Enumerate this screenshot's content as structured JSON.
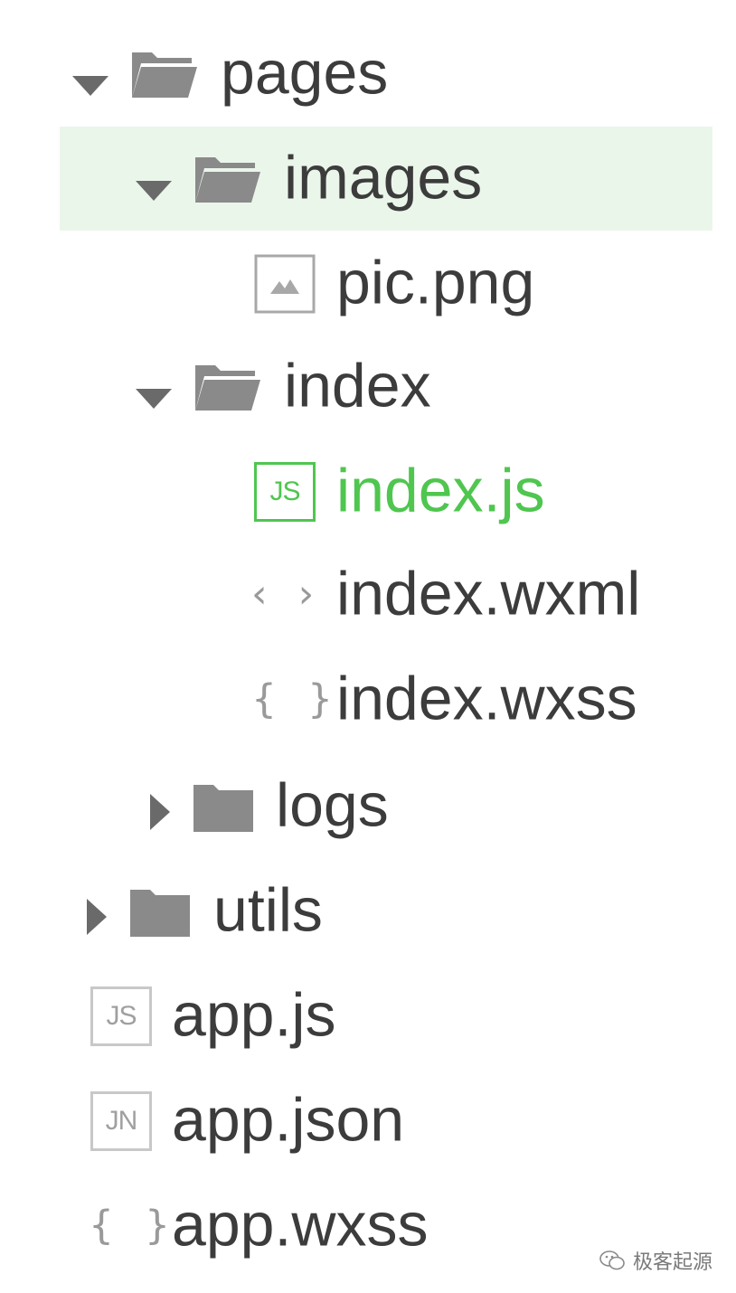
{
  "tree": {
    "pages": {
      "label": "pages",
      "icon": "folder-open-icon",
      "expanded": true
    },
    "images": {
      "label": "images",
      "icon": "folder-open-icon",
      "expanded": true,
      "selected": true
    },
    "pic_png": {
      "label": "pic.png",
      "icon": "image-file-icon"
    },
    "index_folder": {
      "label": "index",
      "icon": "folder-open-icon",
      "expanded": true
    },
    "index_js": {
      "label": "index.js",
      "icon": "js-file-icon",
      "badge": "JS",
      "active": true
    },
    "index_wxml": {
      "label": "index.wxml",
      "icon": "code-file-icon",
      "glyph": "‹ ›"
    },
    "index_wxss": {
      "label": "index.wxss",
      "icon": "style-file-icon",
      "glyph": "{ }"
    },
    "logs": {
      "label": "logs",
      "icon": "folder-closed-icon",
      "expanded": false
    },
    "utils": {
      "label": "utils",
      "icon": "folder-closed-icon",
      "expanded": false
    },
    "app_js": {
      "label": "app.js",
      "icon": "js-file-icon",
      "badge": "JS"
    },
    "app_json": {
      "label": "app.json",
      "icon": "json-file-icon",
      "badge": "JN"
    },
    "app_wxss": {
      "label": "app.wxss",
      "icon": "style-file-icon",
      "glyph": "{ }"
    }
  },
  "watermark": {
    "text": "极客起源",
    "icon": "wechat-icon"
  },
  "colors": {
    "text": "#3c3c3c",
    "active": "#4fc64f",
    "selected_bg": "#ebf6eb",
    "icon_gray": "#8a8a8a"
  }
}
